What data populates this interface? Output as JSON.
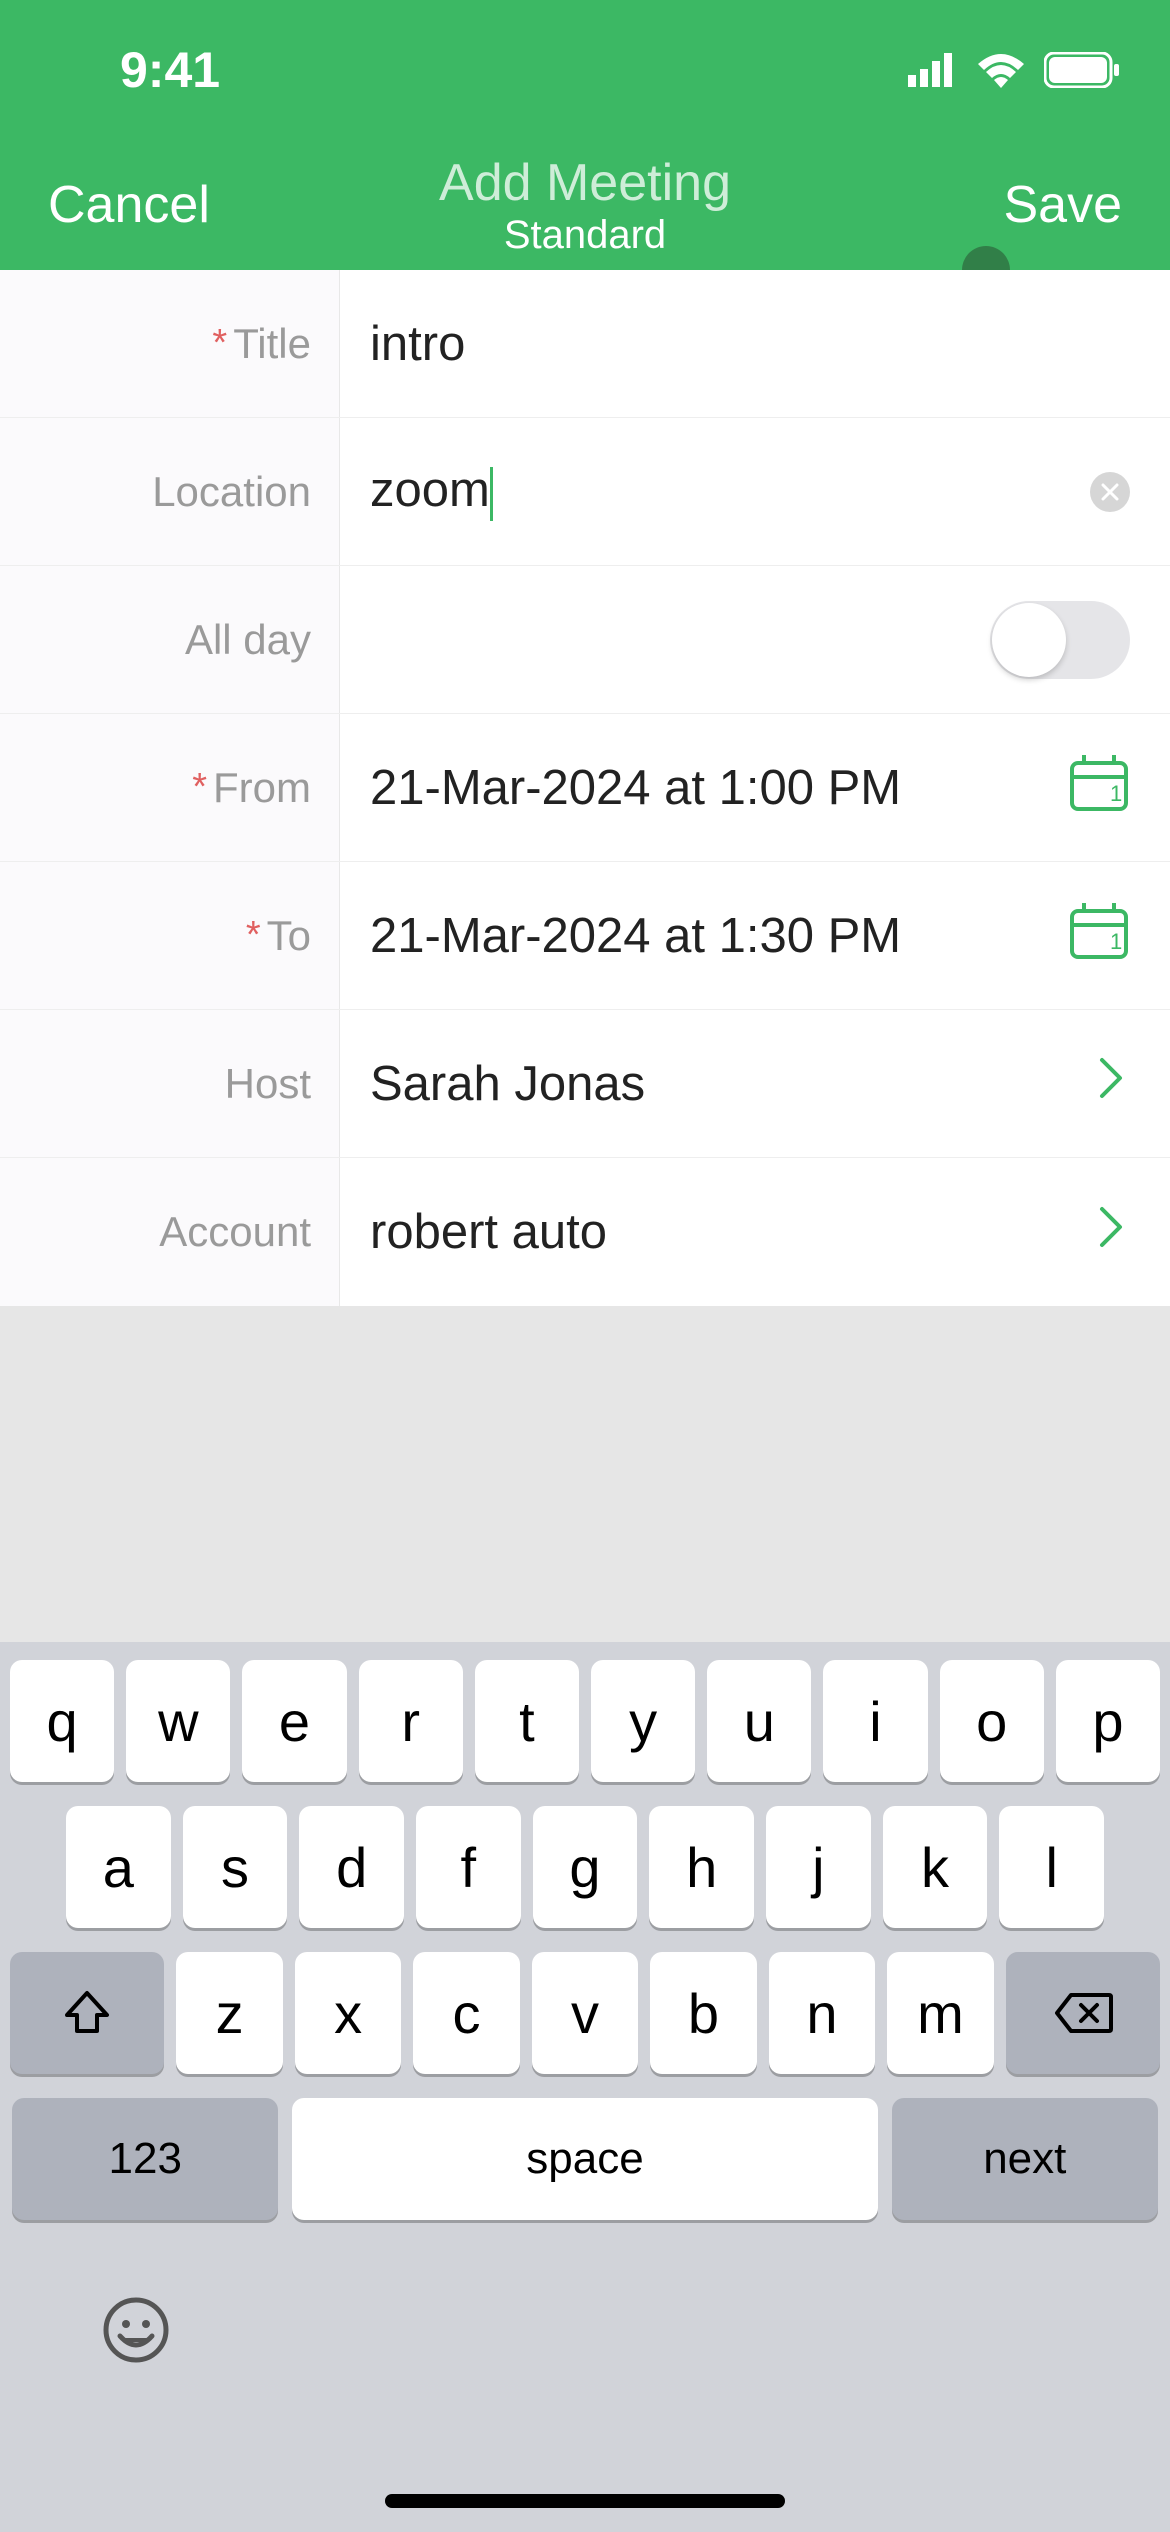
{
  "status": {
    "time": "9:41"
  },
  "nav": {
    "cancel": "Cancel",
    "title": "Add Meeting",
    "subtitle": "Standard",
    "save": "Save"
  },
  "form": {
    "labels": {
      "title": "Title",
      "location": "Location",
      "all_day": "All day",
      "from": "From",
      "to": "To",
      "host": "Host",
      "account": "Account"
    },
    "values": {
      "title": "intro",
      "location": "zoom",
      "from": "21-Mar-2024 at 1:00 PM",
      "to": "21-Mar-2024 at 1:30 PM",
      "host": "Sarah Jonas",
      "account": "robert auto"
    },
    "all_day_on": false
  },
  "keyboard": {
    "row1": [
      "q",
      "w",
      "e",
      "r",
      "t",
      "y",
      "u",
      "i",
      "o",
      "p"
    ],
    "row2": [
      "a",
      "s",
      "d",
      "f",
      "g",
      "h",
      "j",
      "k",
      "l"
    ],
    "row3": [
      "z",
      "x",
      "c",
      "v",
      "b",
      "n",
      "m"
    ],
    "numkey": "123",
    "space": "space",
    "next": "next"
  }
}
